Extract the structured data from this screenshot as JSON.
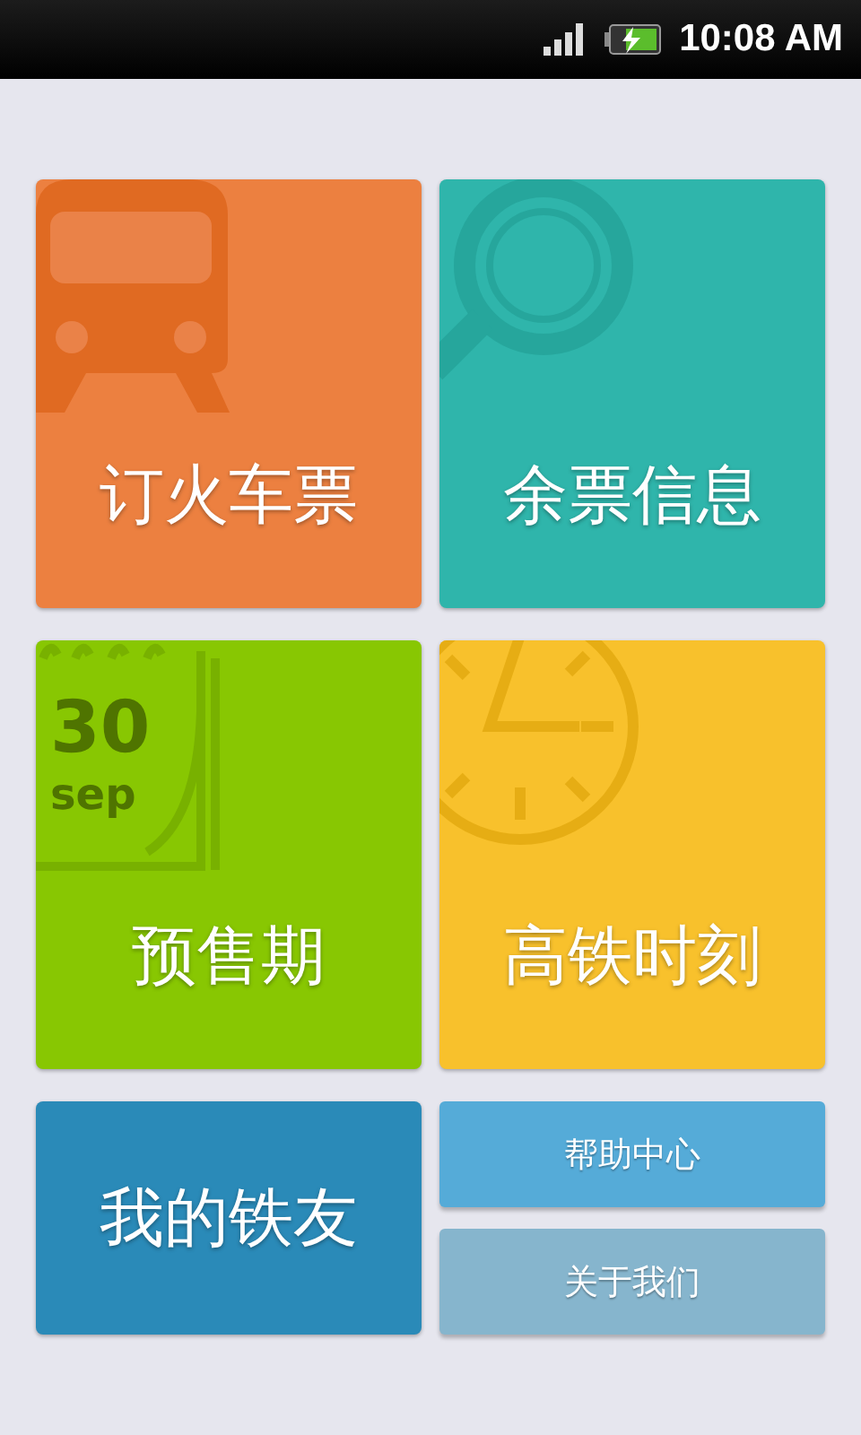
{
  "status_bar": {
    "time": "10:08 AM"
  },
  "tiles": [
    {
      "label": "订火车票",
      "kind": "train",
      "color": "#ec8040"
    },
    {
      "label": "余票信息",
      "kind": "search",
      "color": "#2fb5ab"
    },
    {
      "label": "预售期",
      "kind": "calendar",
      "color": "#88c702",
      "calendar_day": "30",
      "calendar_month": "sep"
    },
    {
      "label": "高铁时刻",
      "kind": "clock",
      "color": "#f8c12c"
    },
    {
      "label": "我的铁友",
      "kind": "plain",
      "color": "#2a8ab8"
    }
  ],
  "small_buttons": [
    {
      "label": "帮助中心",
      "color": "#55abd8"
    },
    {
      "label": "关于我们",
      "color": "#86b5cd"
    }
  ]
}
